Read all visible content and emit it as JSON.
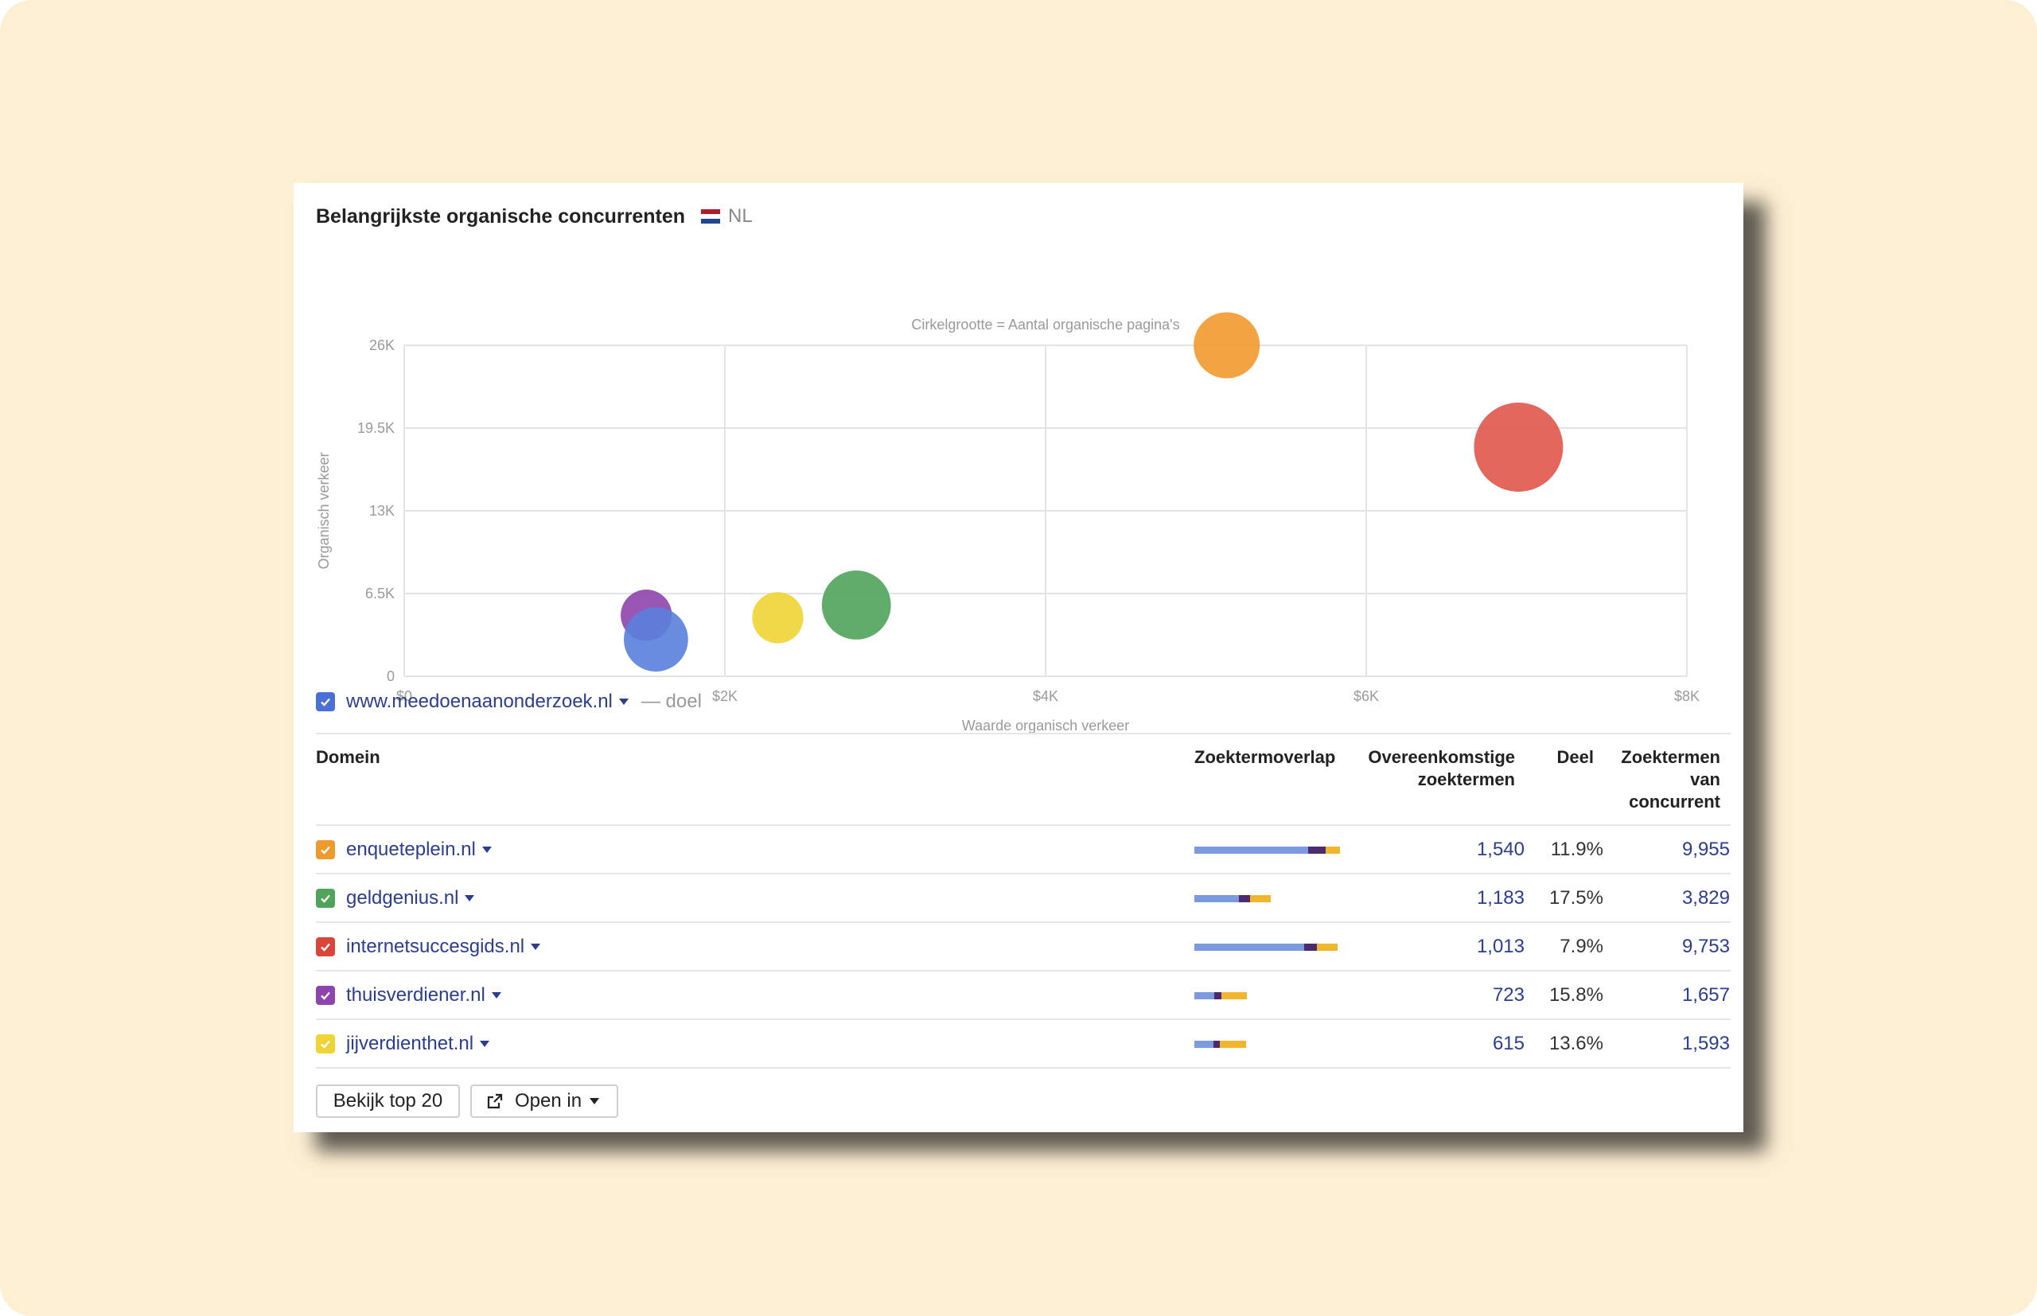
{
  "widget": {
    "title": "Belangrijkste organische concurrenten",
    "country_code": "NL",
    "flag_colors": [
      "#ae1c28",
      "#ffffff",
      "#21468b"
    ]
  },
  "chart_data": {
    "type": "scatter",
    "subtitle": "Cirkelgrootte = Aantal organische pagina's",
    "xlabel": "Waarde organisch verkeer",
    "ylabel": "Organisch verkeer",
    "xlim": [
      0,
      8000
    ],
    "ylim": [
      0,
      26000
    ],
    "x_ticks": [
      "$0",
      "$2K",
      "$4K",
      "$6K",
      "$8K"
    ],
    "y_ticks": [
      "0",
      "6.5K",
      "13K",
      "19.5K",
      "26K"
    ],
    "grid": true,
    "size_encoding": "Aantal organische pagina's",
    "points": [
      {
        "domain": "enqueteplein.nl",
        "x": 5130,
        "y": 26000,
        "size": 0.55,
        "color": "#ef9a2c"
      },
      {
        "domain": "internetsuccesgids.nl",
        "x": 6950,
        "y": 18000,
        "size": 1.0,
        "color": "#e0574b"
      },
      {
        "domain": "geldgenius.nl",
        "x": 2820,
        "y": 5600,
        "size": 0.6,
        "color": "#4fa35a"
      },
      {
        "domain": "jijverdienthet.nl",
        "x": 2330,
        "y": 4600,
        "size": 0.33,
        "color": "#f0d435"
      },
      {
        "domain": "thuisverdiener.nl",
        "x": 1510,
        "y": 4800,
        "size": 0.33,
        "color": "#8e44ad"
      },
      {
        "domain": "www.meedoenaanonderzoek.nl",
        "x": 1570,
        "y": 2900,
        "size": 0.52,
        "color": "#5a7fdb"
      }
    ]
  },
  "target": {
    "domain": "www.meedoenaanonderzoek.nl",
    "suffix": "— doel",
    "color": "#4a6fd6"
  },
  "table": {
    "headers": {
      "domain": "Domein",
      "overlap": "Zoektermoverlap",
      "common_1": "Overeenkomstige",
      "common_2": "zoektermen",
      "share": "Deel",
      "comp_1": "Zoektermen",
      "comp_2": "van",
      "comp_3": "concurrent"
    },
    "rows": [
      {
        "domain": "enqueteplein.nl",
        "color": "#ef9a2c",
        "common": "1,540",
        "share": "11.9%",
        "competitor": "9,955",
        "bar": [
          143,
          22,
          18
        ]
      },
      {
        "domain": "geldgenius.nl",
        "color": "#4fa35a",
        "common": "1,183",
        "share": "17.5%",
        "competitor": "3,829",
        "bar": [
          56,
          14,
          26
        ]
      },
      {
        "domain": "internetsuccesgids.nl",
        "color": "#d9453a",
        "common": "1,013",
        "share": "7.9%",
        "competitor": "9,753",
        "bar": [
          138,
          16,
          26
        ]
      },
      {
        "domain": "thuisverdiener.nl",
        "color": "#8e44ad",
        "common": "723",
        "share": "15.8%",
        "competitor": "1,657",
        "bar": [
          25,
          9,
          32
        ]
      },
      {
        "domain": "jijverdienthet.nl",
        "color": "#f0d435",
        "common": "615",
        "share": "13.6%",
        "competitor": "1,593",
        "bar": [
          24,
          8,
          33
        ]
      }
    ],
    "bar_colors": [
      "#7b9ae0",
      "#4b2a6e",
      "#f0b72e"
    ]
  },
  "buttons": {
    "top": "Bekijk top 20",
    "open": "Open in"
  }
}
